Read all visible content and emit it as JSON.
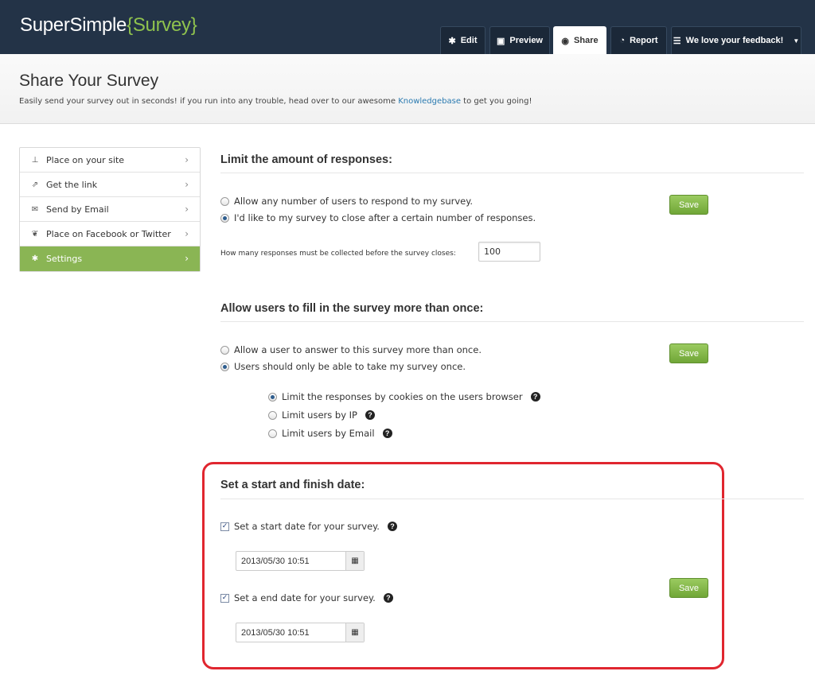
{
  "brand": {
    "part1": "SuperSimple",
    "part2": "{Survey}"
  },
  "nav": {
    "edit": "Edit",
    "preview": "Preview",
    "share": "Share",
    "report": "Report",
    "feedback": "We love your feedback!"
  },
  "header": {
    "title": "Share Your Survey",
    "desc_before": "Easily send your survey out in seconds! if you run into any trouble, head over to our awesome ",
    "desc_link": "Knowledgebase",
    "desc_after": " to get you going!"
  },
  "sidebar": {
    "items": [
      {
        "label": "Place on your site"
      },
      {
        "label": "Get the link"
      },
      {
        "label": "Send by Email"
      },
      {
        "label": "Place on Facebook or Twitter"
      },
      {
        "label": "Settings"
      }
    ]
  },
  "limit": {
    "title": "Limit the amount of responses:",
    "opt_any": "Allow any number of users to respond to my survey.",
    "opt_close": "I'd like to my survey to close after a certain number of responses.",
    "count_label": "How many responses must be collected before the survey closes:",
    "count_value": "100",
    "save": "Save"
  },
  "multi": {
    "title": "Allow users to fill in the survey more than once:",
    "opt_allow": "Allow a user to answer to this survey more than once.",
    "opt_once": "Users should only be able to take my survey once.",
    "sub_cookies": "Limit the responses by cookies on the users browser",
    "sub_ip": "Limit users by IP",
    "sub_email": "Limit users by Email",
    "save": "Save"
  },
  "dates": {
    "title": "Set a start and finish date:",
    "start_label": "Set a start date for your survey.",
    "start_value": "2013/05/30 10:51",
    "end_label": "Set a end date for your survey.",
    "end_value": "2013/05/30 10:51",
    "save": "Save"
  },
  "colors": {
    "topbar": "#233347",
    "accent": "#8fc24e",
    "highlight": "#e0262f"
  }
}
